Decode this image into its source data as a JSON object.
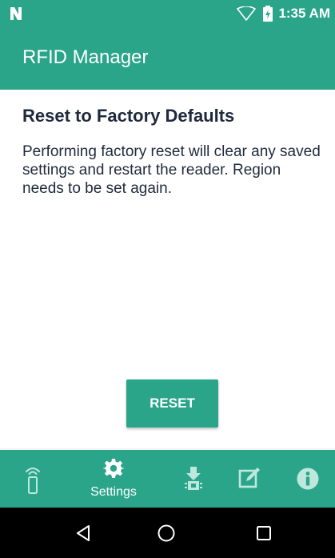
{
  "status_bar": {
    "time": "1:35 AM",
    "left_icon": "n-logo-icon",
    "wifi_icon": "wifi-empty-icon",
    "battery_icon": "battery-charging-icon"
  },
  "app_bar": {
    "title": "RFID Manager"
  },
  "page": {
    "heading": "Reset to Factory Defaults",
    "description": "Performing factory reset will clear any saved settings and restart the reader. Region needs to be set again.",
    "reset_label": "RESET"
  },
  "tabs": [
    {
      "icon": "rfid-reader-icon",
      "label": ""
    },
    {
      "icon": "gear-icon",
      "label": "Settings",
      "selected": true
    },
    {
      "icon": "firmware-update-icon",
      "label": ""
    },
    {
      "icon": "edit-icon",
      "label": ""
    },
    {
      "icon": "info-icon",
      "label": ""
    }
  ],
  "nav": {
    "back_icon": "back-icon",
    "home_icon": "home-icon",
    "recents_icon": "recents-icon"
  },
  "colors": {
    "primary": "#2aa58a",
    "heading_text": "#1f2a3c",
    "inactive_tab_icon": "#bfe8dd",
    "nav_bar": "#000000"
  }
}
